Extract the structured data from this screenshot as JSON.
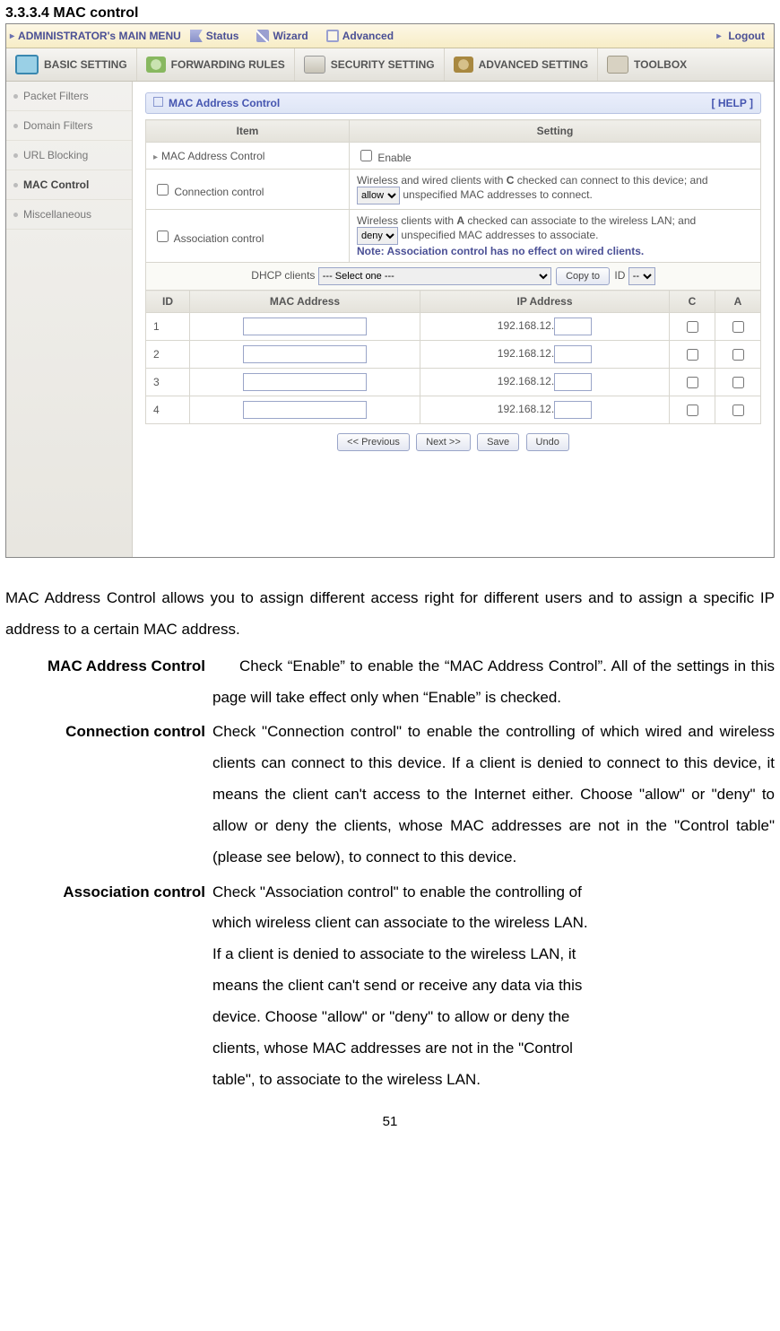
{
  "heading": "3.3.3.4 MAC control",
  "topmenu": {
    "main": "ADMINISTRATOR's MAIN MENU",
    "status": "Status",
    "wizard": "Wizard",
    "advanced": "Advanced",
    "logout": "Logout"
  },
  "navbar": {
    "basic": "BASIC SETTING",
    "forwarding": "FORWARDING RULES",
    "security": "SECURITY SETTING",
    "advsetting": "ADVANCED SETTING",
    "toolbox": "TOOLBOX"
  },
  "sidebar": {
    "items": [
      {
        "label": "Packet Filters"
      },
      {
        "label": "Domain Filters"
      },
      {
        "label": "URL Blocking"
      },
      {
        "label": "MAC Control"
      },
      {
        "label": "Miscellaneous"
      }
    ]
  },
  "panel": {
    "title": "MAC Address Control",
    "help": "[ HELP ]",
    "th_item": "Item",
    "th_setting": "Setting",
    "row_mac_label": "MAC Address Control",
    "row_mac_enable": "Enable",
    "row_conn_label": "Connection control",
    "row_conn_text1": "Wireless and wired clients with ",
    "row_conn_bold": "C",
    "row_conn_text2": " checked can connect to this device; and",
    "row_conn_text3": " unspecified MAC addresses to connect.",
    "row_conn_select": "allow",
    "row_assoc_label": "Association control",
    "row_assoc_text1": "Wireless clients with ",
    "row_assoc_bold": "A",
    "row_assoc_text2": " checked can associate to the wireless LAN; and",
    "row_assoc_text3": " unspecified MAC addresses to associate.",
    "row_assoc_select": "deny",
    "row_assoc_note": "Note: Association control has no effect on wired clients.",
    "dhcp_label": "DHCP clients",
    "dhcp_select": "--- Select one ---",
    "dhcp_copyto": "Copy to",
    "dhcp_id_label": "ID",
    "dhcp_id_select": "--",
    "th_id": "ID",
    "th_mac": "MAC Address",
    "th_ip": "IP Address",
    "th_c": "C",
    "th_a": "A",
    "ip_prefix": "192.168.12.",
    "rows": [
      {
        "id": "1"
      },
      {
        "id": "2"
      },
      {
        "id": "3"
      },
      {
        "id": "4"
      }
    ],
    "btn_prev": "<< Previous",
    "btn_next": "Next >>",
    "btn_save": "Save",
    "btn_undo": "Undo"
  },
  "doc": {
    "intro": "MAC Address Control allows you to assign different access right for different users and to assign a specific IP address to a certain MAC address.",
    "defs": [
      {
        "term": "MAC Address Control",
        "desc": "Check “Enable” to enable the “MAC Address Control”. All of the settings in this page will take effect only when “Enable” is checked.",
        "narrow": false,
        "indent": true
      },
      {
        "term": "Connection control",
        "desc": "Check \"Connection control\" to enable the controlling of which wired and wireless clients can connect to this device. If a client is denied to connect to this device, it means the client can't access to the Internet either. Choose \"allow\" or \"deny\" to allow or deny the clients, whose MAC addresses are not in the \"Control table\" (please see below), to connect to this device.",
        "narrow": false,
        "indent": false
      },
      {
        "term": "Association control",
        "desc": "Check \"Association control\" to enable the controlling of which wireless client can associate to the wireless LAN. If a client is denied to associate to the wireless LAN, it means the client can't send or receive any data via this device. Choose \"allow\" or \"deny\" to allow or deny the clients, whose MAC addresses are not in the \"Control table\", to associate to the wireless LAN.",
        "narrow": true,
        "indent": false
      }
    ],
    "page_number": "51"
  }
}
